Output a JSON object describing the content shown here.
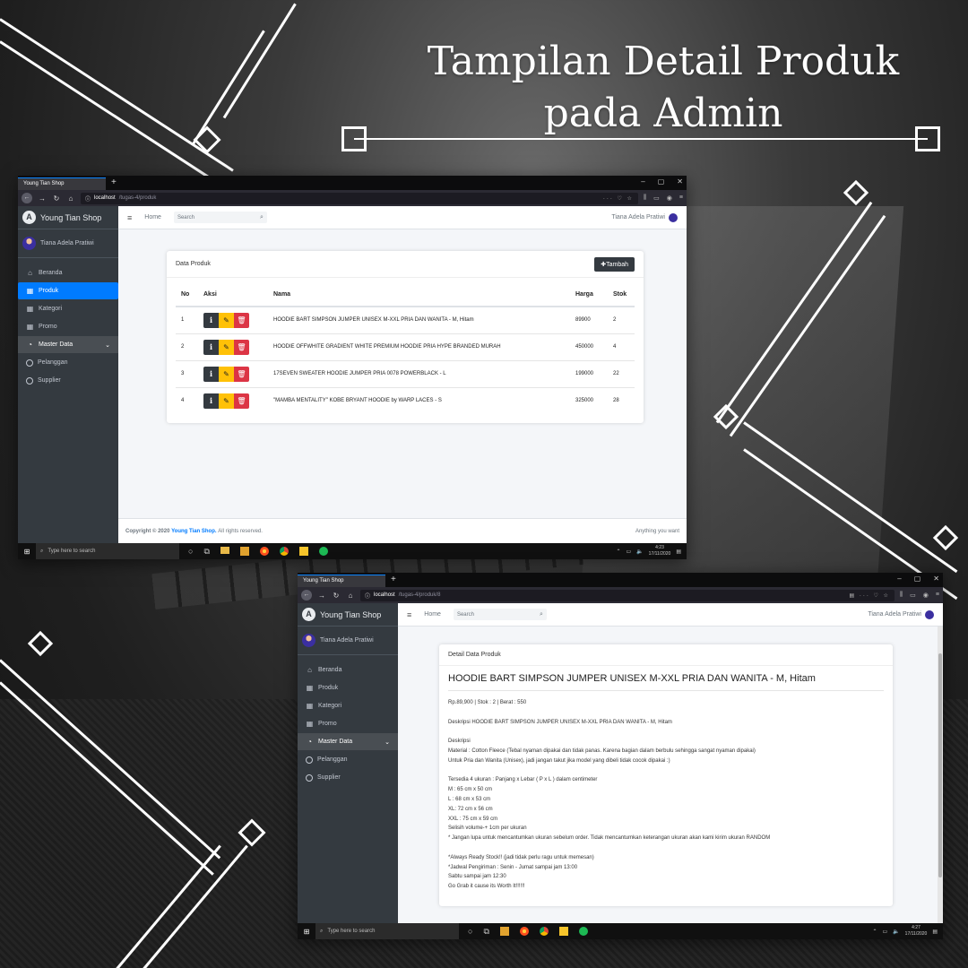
{
  "hero": {
    "line1": "Tampilan Detail Produk",
    "line2": "pada Admin"
  },
  "browser": {
    "tab_title": "Young Tian Shop",
    "new_tab_icon": "+",
    "url_host": "localhost",
    "url_path_list": "/tugas-4/produk",
    "url_path_detail": "/tugas-4/produk/8",
    "window_controls": [
      "–",
      "▢",
      "✕"
    ]
  },
  "app": {
    "brand": "Young Tian Shop",
    "brand_logo_letter": "A",
    "user_name": "Tiana Adela Pratiwi",
    "menu": {
      "beranda": "Beranda",
      "produk": "Produk",
      "kategori": "Kategori",
      "promo": "Promo",
      "master_data": "Master Data",
      "pelanggan": "Pelanggan",
      "supplier": "Supplier"
    },
    "topnav": {
      "home": "Home",
      "search_placeholder": "Search",
      "user": "Tiana Adela Pratiwi"
    }
  },
  "product_list": {
    "card_title": "Data Produk",
    "add_button": "Tambah",
    "columns": [
      "No",
      "Aksi",
      "Nama",
      "Harga",
      "Stok"
    ],
    "rows": [
      {
        "no": "1",
        "nama": "HOODIE BART SIMPSON JUMPER UNISEX M-XXL PRIA DAN WANITA - M, Hitam",
        "harga": "89900",
        "stok": "2"
      },
      {
        "no": "2",
        "nama": "HOODIE OFFWHITE GRADIENT WHITE PREMIUM HOODIE PRIA HYPE BRANDED MURAH",
        "harga": "450000",
        "stok": "4"
      },
      {
        "no": "3",
        "nama": "17SEVEN SWEATER HOODIE JUMPER PRIA 0078 POWERBLACK - L",
        "harga": "199000",
        "stok": "22"
      },
      {
        "no": "4",
        "nama": "\"MAMBA MENTALITY\" KOBE BRYANT HOODIE by WARP LACES - S",
        "harga": "325000",
        "stok": "28"
      }
    ]
  },
  "footer": {
    "copyright": "Copyright © 2020",
    "shop_link": "Young Tian Shop.",
    "rights": "All rights reserved.",
    "right_text": "Anything you want"
  },
  "taskbar": {
    "search_placeholder": "Type here to search",
    "time_1": "4:23",
    "date_1": "17/11/2020",
    "time_2": "4:27",
    "date_2": "17/11/2020"
  },
  "product_detail": {
    "card_title": "Detail Data Produk",
    "title": "HOODIE BART SIMPSON JUMPER UNISEX M-XXL PRIA DAN WANITA - M, Hitam",
    "meta": "Rp.89,900 | Stok : 2 | Berat : 550",
    "desc_heading_line": "Deskripsi HOODIE BART SIMPSON JUMPER UNISEX M-XXL PRIA DAN WANITA - M, Hitam",
    "desc_label": "Deskripsi",
    "material": "Material : Cotton Fleece (Tebal nyaman dipakai dan tidak panas. Karena bagian dalam berbulu sehingga sangat nyaman dipakai)",
    "unisex": "Untuk Pria dan Wanita (Unisex), jadi jangan takut jika model yang dibeli tidak cocok dipakai :)",
    "sizes_intro": "Tersedia 4 ukuran : Panjang x Lebar ( P x L ) dalam centimeter",
    "size_m": "M : 65 cm x 50 cm",
    "size_l": "L : 68 cm x 53 cm",
    "size_xl": "XL: 72 cm x 56 cm",
    "size_xxl": "XXL : 75 cm x 59 cm",
    "volume": "Selisih volume-+ 1cm per ukuran",
    "note": "* Jangan lupa untuk mencantumkan ukuran sebelum order. Tidak mencantumkan keterangan ukuran akan kami kirim ukuran RANDOM",
    "ready": "*Always Ready Stock!! (jadi tidak perlu ragu untuk memesan)",
    "schedule": "*Jadwal Pengiriman : Senin - Jumat sampai jam 13:00",
    "saturday": "Sabtu sampai jam 12:30",
    "grab": "Go Grab it cause its Worth It!!!!!!"
  },
  "icons": {
    "home": "home-icon",
    "grid": "grid-icon",
    "dashboard": "dashboard-icon",
    "circle": "circle-icon",
    "search": "search-icon",
    "hamburger": "hamburger-icon",
    "info": "info-icon",
    "edit": "edit-icon",
    "trash": "trash-icon"
  },
  "colors": {
    "sidebar": "#343a40",
    "active": "#007bff",
    "edit": "#ffc107",
    "delete": "#dc3545",
    "dark_button": "#343a40"
  }
}
